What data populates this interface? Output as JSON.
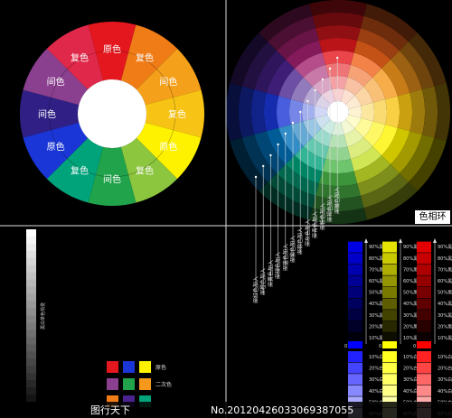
{
  "wheel_left": {
    "segments": [
      {
        "label": "原色",
        "color": "#e3171d"
      },
      {
        "label": "复色",
        "color": "#f07c17"
      },
      {
        "label": "间色",
        "color": "#f5a01a"
      },
      {
        "label": "复色",
        "color": "#f7c314"
      },
      {
        "label": "原色",
        "color": "#fef200"
      },
      {
        "label": "复色",
        "color": "#8cc63f"
      },
      {
        "label": "间色",
        "color": "#20a34a"
      },
      {
        "label": "复色",
        "color": "#00a37a"
      },
      {
        "label": "原色",
        "color": "#1b36d6"
      },
      {
        "label": "间色",
        "color": "#302085"
      },
      {
        "label": "间色",
        "color": "#8a3f8f"
      },
      {
        "label": "复色",
        "color": "#e0294a"
      }
    ]
  },
  "wheel_right": {
    "title": "色相环",
    "hues": [
      "#e3171d",
      "#f0631a",
      "#f5981c",
      "#f7c314",
      "#fef200",
      "#c6e02a",
      "#4bb648",
      "#00a37a",
      "#0070b8",
      "#1b36d6",
      "#4a2390",
      "#a3206e"
    ]
  },
  "pointer_labels": [
    "深红色加入",
    "深橙色加入",
    "深黄色加入",
    "深绿色加入",
    "深蓝色加入",
    "深紫色加入",
    "深棕色加入",
    "深灰色加入",
    "深青色加入",
    "深粉色加入",
    "深褐色加入",
    "深橄色加入"
  ],
  "gray_scale_label": "黑白单色渐变",
  "swatch_legend": {
    "rows": [
      {
        "label": "原色",
        "colors": [
          "#e3171d",
          "#1b36d6",
          "#fef200"
        ]
      },
      {
        "label": "二次色",
        "colors": [
          "#8a3f8f",
          "#20a34a",
          "#f5981c"
        ]
      },
      {
        "label": "",
        "colors": [
          "#f07c17",
          "#4a2390",
          "#00a37a"
        ]
      }
    ]
  },
  "scales": {
    "zero_label": "0",
    "top_labels": [
      "90%黑",
      "80%黑",
      "70%黑",
      "60%黑",
      "50%黑",
      "40%黑",
      "30%黑",
      "20%黑",
      "10%黑"
    ],
    "bottom_labels": [
      "10%白",
      "20%白",
      "30%白",
      "40%白",
      "50%白",
      "60%白"
    ],
    "bars": [
      {
        "name": "blue",
        "base": "#0000ff"
      },
      {
        "name": "yellow",
        "base": "#ffff00"
      },
      {
        "name": "red",
        "base": "#ff0000"
      }
    ]
  },
  "watermark": {
    "brand": "图行天下",
    "number": "No.20120426033069387055"
  }
}
